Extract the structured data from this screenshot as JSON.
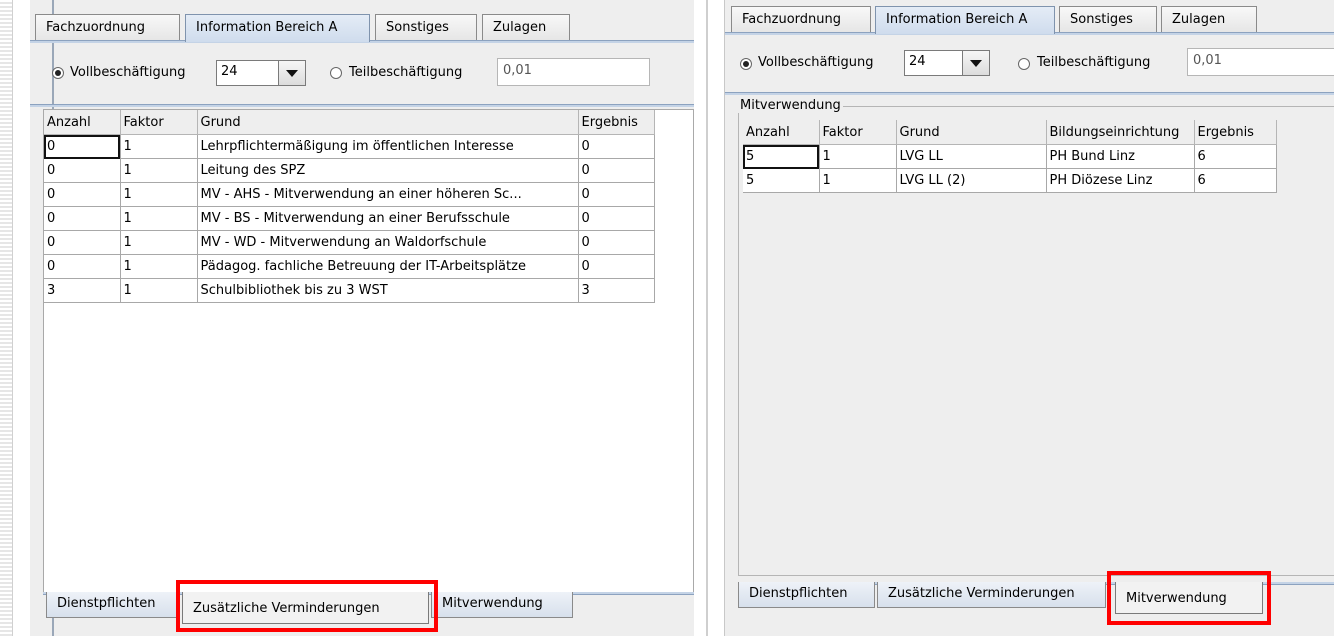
{
  "left": {
    "top_tabs": [
      "Fachzuordnung",
      "Information Bereich A",
      "Sonstiges",
      "Zulagen"
    ],
    "vollbeschaeftigung_label": "Vollbeschäftigung",
    "combo_value": "24",
    "teilbeschaeftigung_label": "Teilbeschäftigung",
    "teil_value": "0,01",
    "columns": [
      "Anzahl",
      "Faktor",
      "Grund",
      "Ergebnis"
    ],
    "rows": [
      [
        "0",
        "1",
        "Lehrpflichtermäßigung im öffentlichen Interesse",
        "0"
      ],
      [
        "0",
        "1",
        "Leitung des SPZ",
        "0"
      ],
      [
        "0",
        "1",
        "MV - AHS - Mitverwendung an einer höheren Sc...",
        "0"
      ],
      [
        "0",
        "1",
        "MV - BS - Mitverwendung an einer Berufsschule",
        "0"
      ],
      [
        "0",
        "1",
        "MV - WD - Mitverwendung an Waldorfschule",
        "0"
      ],
      [
        "0",
        "1",
        "Pädagog. fachliche Betreuung der IT-Arbeitsplätze",
        "0"
      ],
      [
        "3",
        "1",
        "Schulbibliothek bis zu 3 WST",
        "3"
      ]
    ],
    "bottom_tabs": [
      "Dienstpflichten",
      "Zusätzliche Verminderungen",
      "Mitverwendung"
    ]
  },
  "right": {
    "top_tabs": [
      "Fachzuordnung",
      "Information Bereich A",
      "Sonstiges",
      "Zulagen"
    ],
    "vollbeschaeftigung_label": "Vollbeschäftigung",
    "combo_value": "24",
    "teilbeschaeftigung_label": "Teilbeschäftigung",
    "teil_value": "0,01",
    "group_title": "Mitverwendung",
    "columns": [
      "Anzahl",
      "Faktor",
      "Grund",
      "Bildungseinrichtung",
      "Ergebnis"
    ],
    "rows": [
      [
        "5",
        "1",
        "LVG LL",
        "PH Bund Linz",
        "6"
      ],
      [
        "5",
        "1",
        "LVG LL (2)",
        "PH Diözese Linz",
        "6"
      ]
    ],
    "bottom_tabs": [
      "Dienstpflichten",
      "Zusätzliche Verminderungen",
      "Mitverwendung"
    ]
  },
  "colors": {
    "highlight": "#ff0000",
    "active_tab": "#cfdced"
  }
}
